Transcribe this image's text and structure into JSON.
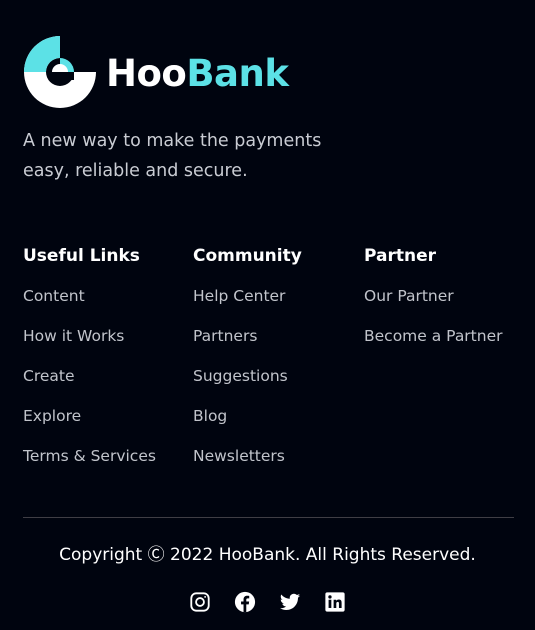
{
  "brand": {
    "name_part1": "Hoo",
    "name_part2": "Bank",
    "accent_color": "#5ce1e6",
    "background_color": "#00040f"
  },
  "tagline": "A new way to make the payments easy, reliable and secure.",
  "columns": [
    {
      "title": "Useful Links",
      "links": [
        "Content",
        "How it Works",
        "Create",
        "Explore",
        "Terms & Services"
      ]
    },
    {
      "title": "Community",
      "links": [
        "Help Center",
        "Partners",
        "Suggestions",
        "Blog",
        "Newsletters"
      ]
    },
    {
      "title": "Partner",
      "links": [
        "Our Partner",
        "Become a Partner"
      ]
    }
  ],
  "copyright": "Copyright Ⓒ 2022 HooBank. All Rights Reserved.",
  "socials": [
    {
      "icon": "instagram-icon"
    },
    {
      "icon": "facebook-icon"
    },
    {
      "icon": "twitter-icon"
    },
    {
      "icon": "linkedin-icon"
    }
  ]
}
